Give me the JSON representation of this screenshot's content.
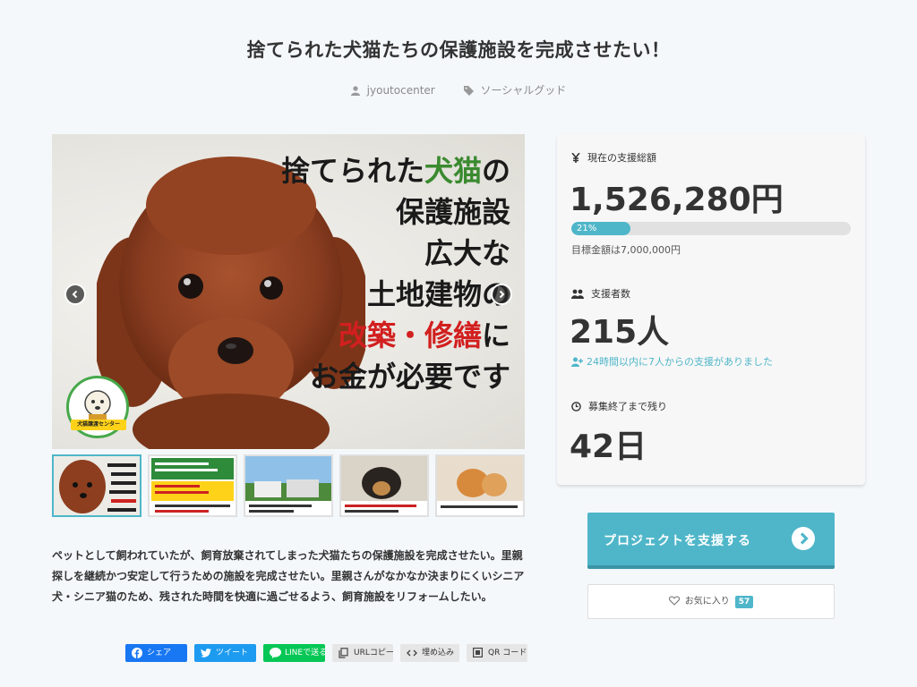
{
  "header": {
    "title": "捨てられた犬猫たちの保護施設を完成させたい！",
    "author": "jyoutocenter",
    "category": "ソーシャルグッド"
  },
  "hero": {
    "lines": [
      "捨てられた",
      "犬猫",
      "の",
      "保護施設",
      "広大な",
      "土地建物の",
      "改築・修繕",
      "に",
      "お金が必要です"
    ],
    "logo_text": "犬猫譲渡センター",
    "prev_icon": "chevron-left-icon",
    "next_icon": "chevron-right-icon"
  },
  "thumbnails": [
    {
      "name": "thumb-1",
      "active": true
    },
    {
      "name": "thumb-2",
      "active": false
    },
    {
      "name": "thumb-3",
      "active": false
    },
    {
      "name": "thumb-4",
      "active": false
    },
    {
      "name": "thumb-5",
      "active": false
    }
  ],
  "stats": {
    "total_label": "現在の支援総額",
    "total_value": "1,526,280円",
    "progress_percent": 21,
    "progress_label": "21%",
    "goal_text": "目標金額は7,000,000円",
    "backers_label": "支援者数",
    "backers_value": "215人",
    "recent_text": "24時間以内に7人からの支援がありました",
    "remaining_label": "募集終了まで残り",
    "remaining_value": "42日"
  },
  "actions": {
    "support_label": "プロジェクトを支援する",
    "favorite_label": "お気に入り",
    "favorite_count": "57"
  },
  "description": "ペットとして飼われていたが、飼育放棄されてしまった犬猫たちの保護施設を完成させたい。里親探しを継続かつ安定して行うための施設を完成させたい。里親さんがなかなか決まりにくいシニア犬・シニア猫のため、残された時間を快適に過ごせるよう、飼育施設をリフォームしたい。",
  "share": {
    "facebook": "シェア",
    "twitter": "ツイート",
    "line": "LINEで送る",
    "url_copy": "URLコピー",
    "embed": "埋め込み",
    "qr": "QR コード"
  },
  "colors": {
    "accent": "#4fb6c9",
    "facebook": "#1877f2",
    "twitter": "#1d9bf0",
    "line": "#06c755"
  }
}
